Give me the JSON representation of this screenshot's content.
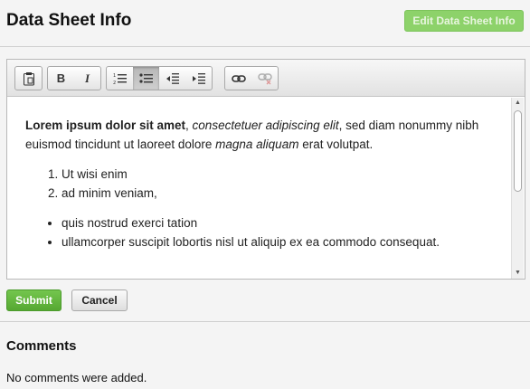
{
  "header": {
    "title": "Data Sheet Info",
    "edit_button": "Edit Data Sheet Info"
  },
  "toolbar": {
    "groups": [
      [
        "paste-icon"
      ],
      [
        "bold-icon",
        "italic-icon"
      ],
      [
        "numbered-list-icon",
        "bulleted-list-icon",
        "outdent-icon",
        "indent-icon"
      ],
      [
        "link-icon",
        "unlink-icon"
      ]
    ],
    "bold_label": "B",
    "italic_label": "I"
  },
  "content": {
    "p_bold": "Lorem ipsum dolor sit amet",
    "p_comma": ", ",
    "p_italic": "consectetuer adipiscing elit",
    "p_mid": ", sed diam nonummy nibh euismod tincidunt ut laoreet dolore ",
    "p_italic2": "magna aliquam",
    "p_end": " erat volutpat.",
    "ordered": [
      "Ut wisi enim",
      "ad minim veniam,"
    ],
    "unordered": [
      "quis nostrud exerci tation",
      "ullamcorper suscipit lobortis nisl ut aliquip ex ea commodo consequat."
    ]
  },
  "actions": {
    "submit": "Submit",
    "cancel": "Cancel"
  },
  "comments": {
    "title": "Comments",
    "empty": "No comments were added."
  },
  "colors": {
    "accent_green": "#5cb336",
    "edit_button_green": "#8dd26a"
  }
}
